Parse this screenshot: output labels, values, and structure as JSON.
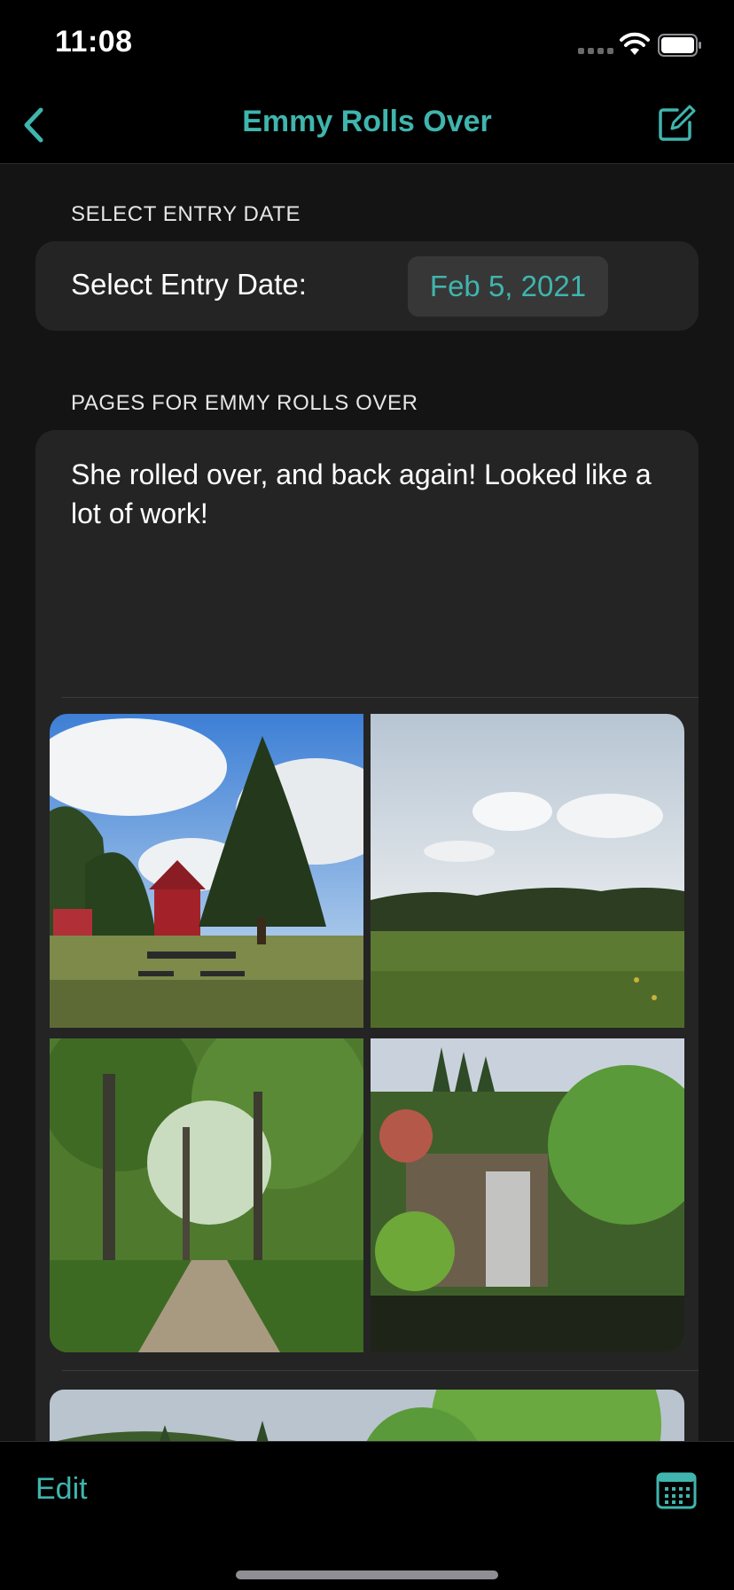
{
  "status_bar": {
    "time": "11:08"
  },
  "nav": {
    "title": "Emmy Rolls Over",
    "back_icon": "chevron-left-icon",
    "compose_icon": "square-pencil-icon"
  },
  "date_section": {
    "header": "SELECT ENTRY DATE",
    "label": "Select Entry Date:",
    "value": "Feb 5, 2021"
  },
  "pages_section": {
    "header": "PAGES FOR EMMY ROLLS OVER",
    "entry_text": "She rolled over, and back again! Looked like a lot of work!",
    "photos": [
      "barn-and-tree-photo",
      "meadow-sky-photo",
      "forest-path-photo",
      "waterfall-garden-photo",
      "garden-photo-partial"
    ]
  },
  "toolbar": {
    "edit_label": "Edit",
    "calendar_icon": "calendar-icon"
  },
  "colors": {
    "accent": "#3fb5ad",
    "card": "#242424",
    "background": "#141414"
  }
}
